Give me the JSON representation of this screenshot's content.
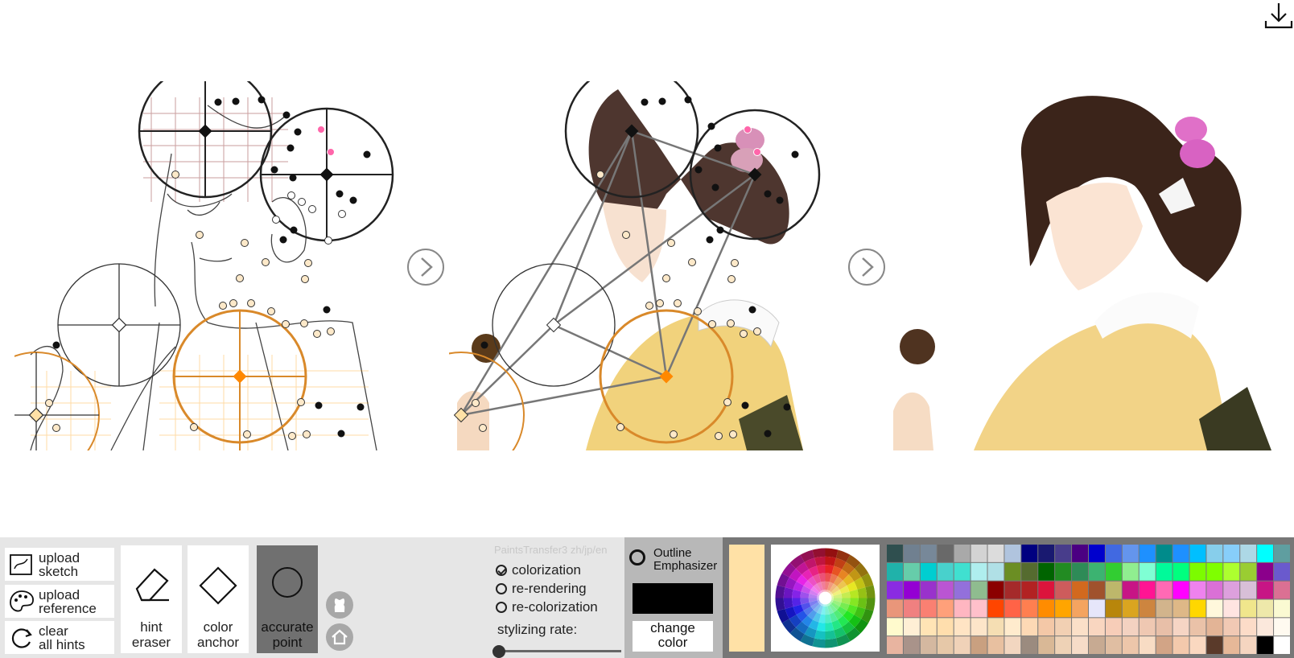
{
  "app": {
    "credit": "PaintsTransfer3 zh/jp/en"
  },
  "icons": {
    "download": "download-icon",
    "next": "chevron-right-circle-icon",
    "github": "github-icon",
    "home": "home-icon"
  },
  "left_buttons": [
    {
      "label": "upload\nsketch",
      "icon": "upload-sketch-icon"
    },
    {
      "label": "upload\nreference",
      "icon": "palette-icon"
    },
    {
      "label": "clear\nall hints",
      "icon": "refresh-icon"
    }
  ],
  "tools": [
    {
      "label": "hint\neraser",
      "icon": "eraser-icon",
      "selected": false
    },
    {
      "label": "color\nanchor",
      "icon": "diamond-icon",
      "selected": false
    },
    {
      "label": "accurate\npoint",
      "icon": "circle-icon",
      "selected": true
    }
  ],
  "modes": [
    {
      "label": "colorization",
      "checked": true
    },
    {
      "label": "re-rendering",
      "checked": false
    },
    {
      "label": "re-colorization",
      "checked": false
    }
  ],
  "stylizing": {
    "label": "stylizing rate:",
    "value": 0
  },
  "outline": {
    "label": "Outline\nEmphasizer",
    "enabled": false
  },
  "color": {
    "current_swatch": "#ffe1a6",
    "change_label": "change\ncolor",
    "outline_color": "#000000"
  },
  "palette": [
    [
      "#2f4f4f",
      "#708090",
      "#778899",
      "#696969",
      "#a9a9a9",
      "#d3d3d3",
      "#dcdcdc",
      "#b0c4de",
      "#000080",
      "#191970",
      "#483d8b",
      "#4b0082",
      "#0000cd",
      "#4169e1",
      "#6495ed",
      "#1e90ff",
      "#008b8b",
      "#1e90ff",
      "#00bfff",
      "#87ceeb",
      "#87cefa",
      "#add8e6",
      "#00ffff",
      "#5f9ea0"
    ],
    [
      "#20b2aa",
      "#66cdaa",
      "#00ced1",
      "#48d1cc",
      "#40e0d0",
      "#afeeee",
      "#b0e0e6",
      "#6b8e23",
      "#556b2f",
      "#006400",
      "#228b22",
      "#2e8b57",
      "#3cb371",
      "#32cd32",
      "#90ee90",
      "#7fffd4",
      "#00fa9a",
      "#00ff7f",
      "#7cfc00",
      "#7fff00",
      "#adff2f",
      "#9acd32",
      "#8b008b",
      "#6a5acd"
    ],
    [
      "#8a2be2",
      "#9400d3",
      "#9932cc",
      "#ba55d3",
      "#9370db",
      "#8fbc8f",
      "#8b0000",
      "#a52a2a",
      "#b22222",
      "#dc143c",
      "#cd5c5c",
      "#d2691e",
      "#a0522d",
      "#bdb76b",
      "#c71585",
      "#ff1493",
      "#ff69b4",
      "#ff00ff",
      "#ee82ee",
      "#da70d6",
      "#dda0dd",
      "#d8bfd8",
      "#c71585",
      "#db7093"
    ],
    [
      "#e9967a",
      "#f08080",
      "#fa8072",
      "#ffa07a",
      "#ffb6c1",
      "#ffc0cb",
      "#ff4500",
      "#ff6347",
      "#ff7f50",
      "#ff8c00",
      "#ffa500",
      "#f4a460",
      "#e6e6fa",
      "#b8860b",
      "#daa520",
      "#cd853f",
      "#d2b48c",
      "#deb887",
      "#ffd700",
      "#fff8dc",
      "#ffe4e1",
      "#f0e68c",
      "#eee8aa",
      "#fafad2"
    ],
    [
      "#fffacd",
      "#ffefd5",
      "#ffe4b5",
      "#ffdead",
      "#ffe4c4",
      "#fde5c9",
      "#f5deb3",
      "#ffebcd",
      "#fdd9b5",
      "#f4c8a7",
      "#f2d0b3",
      "#fbe0c8",
      "#f9d6c0",
      "#f7cdb8",
      "#f3d2c1",
      "#efc8b2",
      "#e8bfa8",
      "#f6d5c4",
      "#eac2a8",
      "#e3b496",
      "#f1c9b4",
      "#fcdcc8",
      "#fbe8dc",
      "#fffaf0"
    ],
    [
      "#e8b4a0",
      "#a9938a",
      "#d4b8a0",
      "#e6c8a8",
      "#f0d2b8",
      "#c9a080",
      "#e8c0a0",
      "#f2d6c0",
      "#9b8b7f",
      "#d9b896",
      "#eed2b6",
      "#f6dcc8",
      "#c7aa92",
      "#e0bea2",
      "#edc6aa",
      "#f8dcc4",
      "#d2a486",
      "#f3c9ac",
      "#fad8c0",
      "#5a3a2a",
      "#e6b898",
      "#f5d5c0",
      "#000000",
      "#ffffff"
    ]
  ]
}
